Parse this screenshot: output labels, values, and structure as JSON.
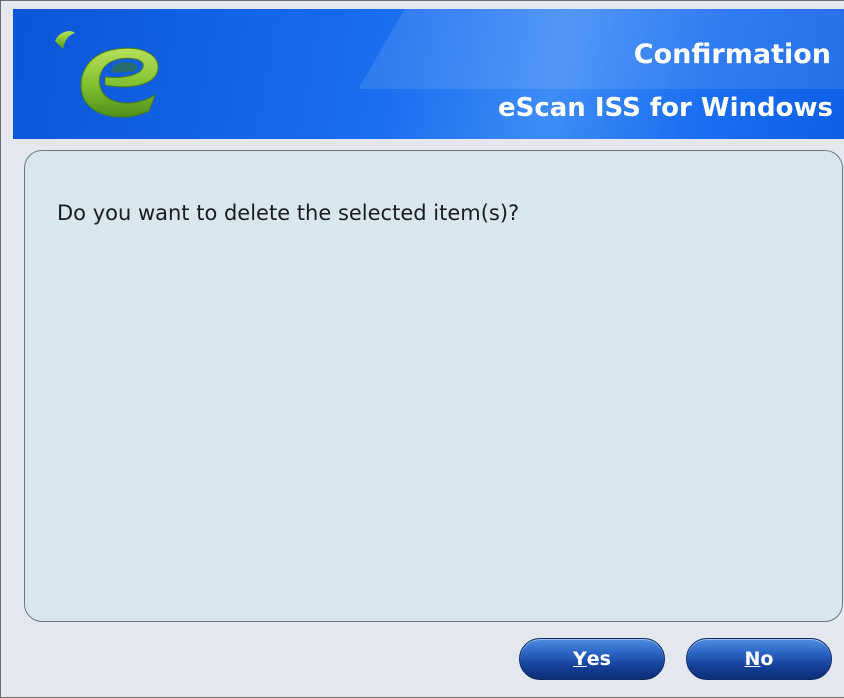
{
  "window": {
    "title": "Confirmation",
    "product_name": "eScan ISS for Windows",
    "logo_icon": "escan-leaf-e-logo-icon"
  },
  "dialog": {
    "message": "Do you want to delete the selected item(s)?"
  },
  "buttons": {
    "yes": {
      "mnemonic": "Y",
      "rest": "es"
    },
    "no": {
      "mnemonic": "N",
      "rest": "o"
    }
  },
  "colors": {
    "header_blue": "#1a6ef0",
    "panel_background": "#d8e6ee",
    "button_blue": "#143f96",
    "logo_green": "#8cc63f"
  }
}
